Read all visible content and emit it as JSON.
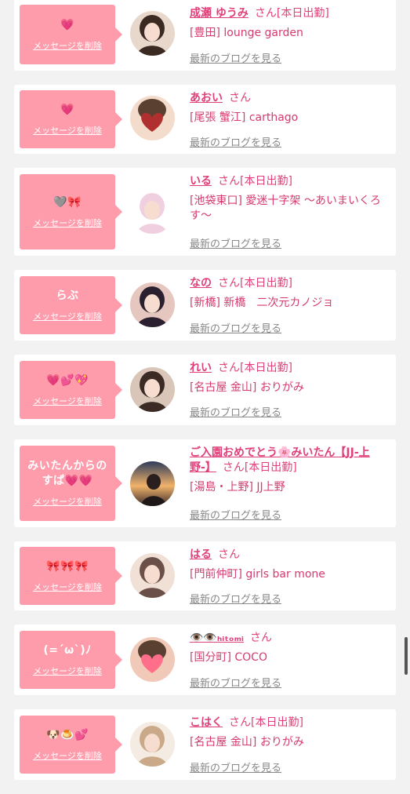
{
  "delete_label": "メッセージを削除",
  "san_label": "さん",
  "blog_label": "最新のブログを見る",
  "colors": {
    "bubble": "#ff9cac",
    "name": "#e0407a",
    "background": "#f2f2f2"
  },
  "items": [
    {
      "message": "💗",
      "name": "成瀬 ゆうみ",
      "shukkin": "[本日出勤]",
      "shop": "[豊田] lounge garden",
      "avatar_icon": "girl-photo"
    },
    {
      "message": "💗",
      "name": "あおい",
      "shukkin": "",
      "shop": "[尾張 蟹江] carthago",
      "avatar_icon": "heart-sticker-photo"
    },
    {
      "message": "🩶🎀",
      "name": "いる",
      "shukkin": "[本日出勤]",
      "shop": "[池袋東口] 愛迷十字架 〜あいまいくろす〜",
      "avatar_icon": "girl-photo"
    },
    {
      "message": "らぶ",
      "name": "なの",
      "shukkin": "[本日出勤]",
      "shop": "[新橋] 新橋　二次元カノジョ",
      "avatar_icon": "girl-photo"
    },
    {
      "message": "💗💕💖",
      "name": "れい",
      "shukkin": "[本日出勤]",
      "shop": "[名古屋 金山] おりがみ",
      "avatar_icon": "girl-photo"
    },
    {
      "message": "みいたんからのすぱ💗💗",
      "name": "ご入園おめでとう🌸みいたん【JJ-上野-】",
      "shukkin": "[本日出勤]",
      "shop": "[湯島・上野] JJ上野",
      "avatar_icon": "sunset-photo"
    },
    {
      "message": "🎀🎀🎀",
      "name": "はる",
      "shukkin": "",
      "shop": "[門前仲町] girls bar mone",
      "avatar_icon": "girl-photo"
    },
    {
      "message": "(=´ω`)ﾉ",
      "name": "👁️👁️ₕᵢₜₒₘᵢ",
      "shukkin": "",
      "shop": "[国分町] COCO",
      "avatar_icon": "heart-sticker-photo"
    },
    {
      "message": "🐶🍮💕",
      "name": "こはく",
      "shukkin": "[本日出勤]",
      "shop": "[名古屋 金山] おりがみ",
      "avatar_icon": "girl-photo"
    }
  ]
}
